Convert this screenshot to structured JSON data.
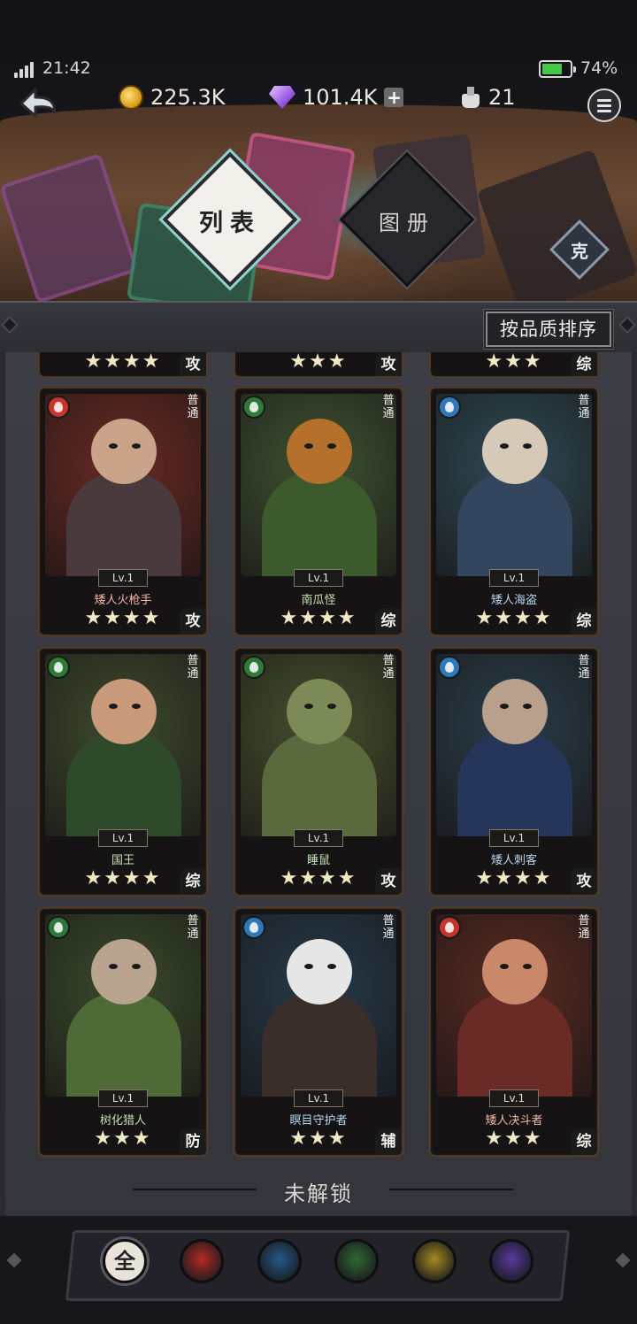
{
  "status_bar": {
    "time": "21:42",
    "battery_pct": "74%",
    "battery_level": 0.74
  },
  "resources": {
    "gold": "225.3K",
    "gems": "101.4K",
    "potions": "21"
  },
  "tabs": {
    "list": "列表",
    "atlas": "图册"
  },
  "counter_badge": "克",
  "sort_button": "按品质排序",
  "partial_row": [
    {
      "stars": "★★★★",
      "role": "攻"
    },
    {
      "stars": "★★★",
      "role": "攻"
    },
    {
      "stars": "★★★",
      "role": "综"
    }
  ],
  "cards": [
    {
      "name": "矮人火枪手",
      "lv": "Lv.1",
      "rarity": "普通",
      "stars": "★★★★",
      "role": "攻",
      "element": "fire",
      "bg": "#6b2a24",
      "skin": "#c9a48a",
      "body": "#4a3a3e",
      "elem_color": "#c7342a",
      "name_color": "#f0b8a8"
    },
    {
      "name": "南瓜怪",
      "lv": "Lv.1",
      "rarity": "普通",
      "stars": "★★★★",
      "role": "综",
      "element": "nature",
      "bg": "#3f5232",
      "skin": "#b5702c",
      "body": "#3d5a2c",
      "elem_color": "#2f7a3a",
      "name_color": "#c9e0b4"
    },
    {
      "name": "矮人海盗",
      "lv": "Lv.1",
      "rarity": "普通",
      "stars": "★★★★",
      "role": "综",
      "element": "water",
      "bg": "#2f4a55",
      "skin": "#d7c9b8",
      "body": "#34465e",
      "elem_color": "#2d78b8",
      "name_color": "#b8d6ec"
    },
    {
      "name": "国王",
      "lv": "Lv.1",
      "rarity": "普通",
      "stars": "★★★★",
      "role": "综",
      "element": "nature",
      "bg": "#3e4a2e",
      "skin": "#c99a7a",
      "body": "#2f4a2a",
      "elem_color": "#2f7a3a",
      "name_color": "#c9e0b4"
    },
    {
      "name": "睡鼠",
      "lv": "Lv.1",
      "rarity": "普通",
      "stars": "★★★★",
      "role": "攻",
      "element": "nature",
      "bg": "#46502e",
      "skin": "#7c8a58",
      "body": "#5b6a3c",
      "elem_color": "#2f7a3a",
      "name_color": "#c9e0b4"
    },
    {
      "name": "矮人刺客",
      "lv": "Lv.1",
      "rarity": "普通",
      "stars": "★★★★",
      "role": "攻",
      "element": "water",
      "bg": "#2a3d4a",
      "skin": "#b9a08c",
      "body": "#26365a",
      "elem_color": "#2d78b8",
      "name_color": "#b8d6ec"
    },
    {
      "name": "树化猎人",
      "lv": "Lv.1",
      "rarity": "普通",
      "stars": "★★★",
      "role": "防",
      "element": "nature",
      "bg": "#3b4a2c",
      "skin": "#b8a48e",
      "body": "#4e6a36",
      "elem_color": "#2f7a3a",
      "name_color": "#c9e0b4"
    },
    {
      "name": "瞑目守护者",
      "lv": "Lv.1",
      "rarity": "普通",
      "stars": "★★★",
      "role": "辅",
      "element": "water",
      "bg": "#263a4a",
      "skin": "#e6e6e6",
      "body": "#3a2e2a",
      "elem_color": "#2d78b8",
      "name_color": "#b8d6ec"
    },
    {
      "name": "矮人决斗者",
      "lv": "Lv.1",
      "rarity": "普通",
      "stars": "★★★",
      "role": "综",
      "element": "fire",
      "bg": "#5a2a22",
      "skin": "#c9886a",
      "body": "#6a2a26",
      "elem_color": "#c7342a",
      "name_color": "#f0b8a8"
    }
  ],
  "locked_label": "未解锁",
  "filters": [
    {
      "name": "all",
      "label": "全"
    },
    {
      "name": "fire",
      "color": "#b52a22"
    },
    {
      "name": "water",
      "color": "#245a8a"
    },
    {
      "name": "nature",
      "color": "#2e6a34"
    },
    {
      "name": "light",
      "color": "#a48a20"
    },
    {
      "name": "shadow",
      "color": "#5a3aa0"
    }
  ]
}
